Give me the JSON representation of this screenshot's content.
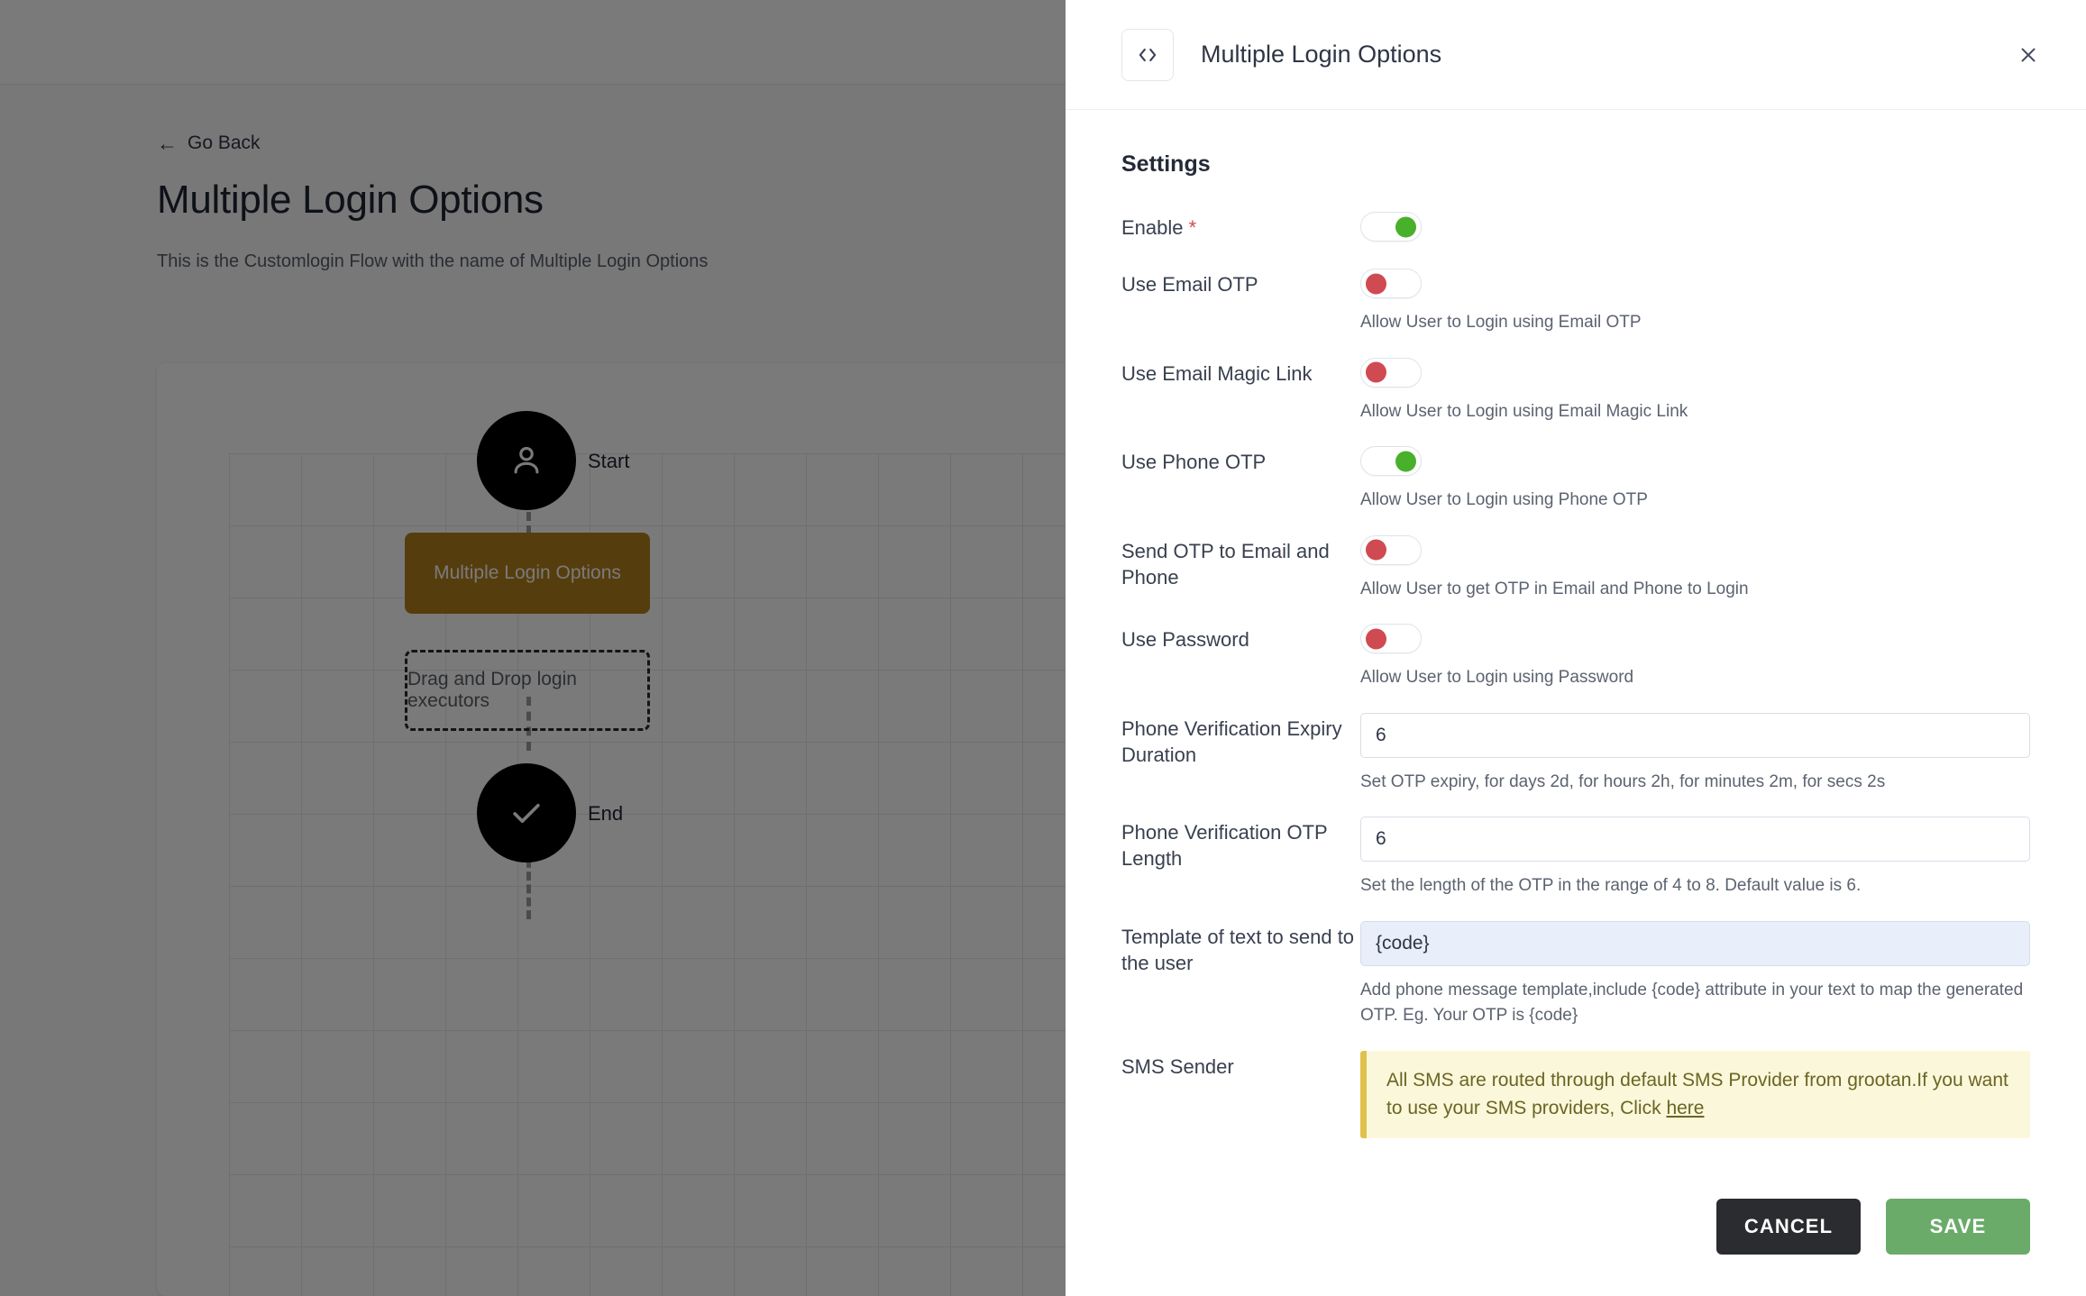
{
  "background": {
    "go_back_label": "Go Back",
    "title": "Multiple Login Options",
    "subtitle": "This is the Customlogin Flow with the name of Multiple Login Options",
    "flow": {
      "start_label": "Start",
      "task_label": "Multiple Login Options",
      "dropzone_label": "Drag and Drop login executors",
      "end_label": "End",
      "task_color": "#b5811d"
    }
  },
  "drawer": {
    "title": "Multiple Login Options",
    "icon": "code-icon",
    "close_icon": "close-icon",
    "section_title": "Settings",
    "toggles": [
      {
        "label": "Enable",
        "required": true,
        "state": "on",
        "helper": ""
      },
      {
        "label": "Use Email OTP",
        "required": false,
        "state": "off",
        "helper": "Allow User to Login using Email OTP"
      },
      {
        "label": "Use Email Magic Link",
        "required": false,
        "state": "off",
        "helper": "Allow User to Login using Email Magic Link"
      },
      {
        "label": "Use Phone OTP",
        "required": false,
        "state": "on",
        "helper": "Allow User to Login using Phone OTP"
      },
      {
        "label": "Send OTP to Email and Phone",
        "required": false,
        "state": "off",
        "helper": "Allow User to get OTP in Email and Phone to Login"
      },
      {
        "label": "Use Password",
        "required": false,
        "state": "off",
        "helper": "Allow User to Login using Password"
      }
    ],
    "fields": [
      {
        "label": "Phone Verification Expiry Duration",
        "value": "6",
        "helper": "Set OTP expiry, for days 2d, for hours 2h, for minutes 2m, for secs 2s",
        "focused": false
      },
      {
        "label": "Phone Verification OTP Length",
        "value": "6",
        "helper": "Set the length of the OTP in the range of 4 to 8. Default value is 6.",
        "focused": false
      },
      {
        "label": "Template of text to send to the user",
        "value": "{code}",
        "helper": "Add phone message template,include {code} attribute in your text to map the generated OTP. Eg. Your OTP is {code}",
        "focused": true
      }
    ],
    "sms_sender": {
      "label": "SMS Sender",
      "notice_text": "All SMS are routed through default SMS Provider from grootan.If you want to use your SMS providers, Click ",
      "notice_link": "here",
      "bg_color": "#fbf7da",
      "accent_color": "#e0c14c",
      "text_color": "#6b6524"
    },
    "footer": {
      "cancel_label": "CANCEL",
      "save_label": "SAVE",
      "cancel_color": "#2b2c30",
      "save_color": "#6aab6a"
    }
  }
}
